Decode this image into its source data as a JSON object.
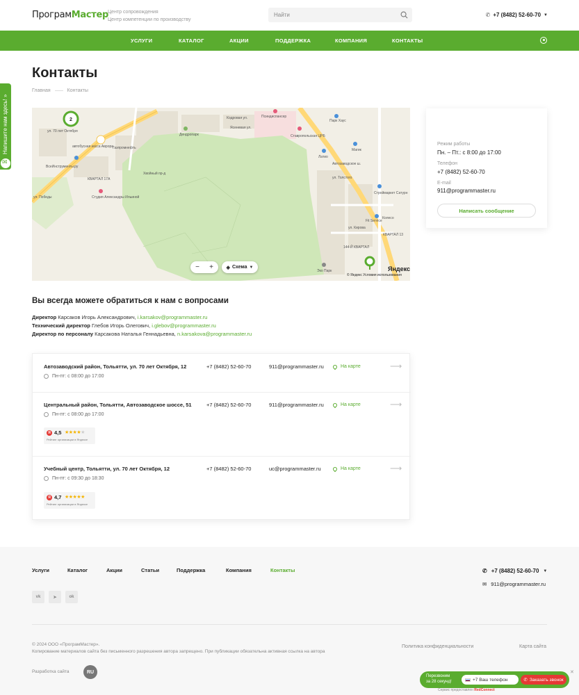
{
  "header": {
    "logo_part1": "Програм",
    "logo_part2": "Мастер",
    "tagline_line1": "Центр сопровождения",
    "tagline_line2": "Центр компетенции по производству",
    "search_placeholder": "Найти",
    "phone": "+7 (8482) 52-60-70"
  },
  "nav": {
    "items": [
      "УСЛУГИ",
      "КАТАЛОГ",
      "АКЦИИ",
      "ПОДДЕРЖКА",
      "КОМПАНИЯ",
      "КОНТАКТЫ"
    ]
  },
  "side_tab": {
    "label": "Напишите нам здесь! »"
  },
  "page": {
    "title": "Контакты",
    "breadcrumbs": [
      "Главная",
      "Контакты"
    ]
  },
  "map": {
    "cluster_count": "2",
    "zoom_minus": "−",
    "zoom_plus": "+",
    "scheme_label": "Схема",
    "brand": "Яндекс",
    "terms": "© Яндекс  Условия использования",
    "labels": [
      "ул. 70 лет Октября",
      "автобусная касса Аврора",
      "Газпромнефть",
      "ВсеИнструменты.ру",
      "Дендропарк",
      "Псиндиспансер",
      "Ставропольская ЦРБ",
      "Парк Хаус",
      "Магик",
      "Латио",
      "Строймаркет Сатурн",
      "Колесо",
      "Fit Service",
      "Студия Александры Ильиной",
      "КВАРТАЛ 17А",
      "КВАРТАЛ 13",
      "144-Й КВАРТАЛ",
      "Автозаводское ш.",
      "ул. Кирова",
      "ул. Толстого",
      "ул. Победы",
      "Эко Парк",
      "Кодровая ул.",
      "Ясеневая ул.",
      "Хвойный пр-д"
    ]
  },
  "info_card": {
    "hours_label": "Режим работы",
    "hours_value": "Пн. – Пт.: с 8:00 до 17:00",
    "phone_label": "Телефон",
    "phone_value": "+7 (8482) 52-60-70",
    "email_label": "E-mail",
    "email_value": "911@programmaster.ru",
    "button": "Написать сообщение"
  },
  "contacts": {
    "title": "Вы всегда можете обратиться к нам с вопросами",
    "people": [
      {
        "role": "Директор",
        "name": "Карсаков Игорь Александрович,",
        "email": "i.karsakov@programmaster.ru"
      },
      {
        "role": "Технический директор",
        "name": "Глебов Игорь Олегович,",
        "email": "i.glebov@programmaster.ru"
      },
      {
        "role": "Директор по персоналу",
        "name": "Карсакова Наталья Геннадьевна,",
        "email": "n.karsakova@programmaster.ru"
      }
    ]
  },
  "offices": [
    {
      "address": "Автозаводский район, Тольятти, ул. 70 лет Октября, 12",
      "hours": "Пн-пт: с 08:00 до 17:00",
      "phone": "+7 (8482) 52-60-70",
      "email": "911@programmaster.ru",
      "map_link": "На карте"
    },
    {
      "address": "Центральный район, Тольятти, Автозаводское шоссе, 51",
      "hours": "Пн-пт: с 08:00 до 17:00",
      "phone": "+7 (8482) 52-60-70",
      "email": "911@programmaster.ru",
      "map_link": "На карте",
      "rating": {
        "score": "4,5",
        "stars": 4.5,
        "caption": "Рейтинг организации в Яндексе"
      }
    },
    {
      "address": "Учебный центр, Тольятти, ул. 70 лет Октября, 12",
      "hours": "Пн-пт: с 09:30 до 18:30",
      "phone": "+7 (8482) 52-60-70",
      "email": "uc@programmaster.ru",
      "map_link": "На карте",
      "rating": {
        "score": "4,7",
        "stars": 5,
        "caption": "Рейтинг организации в Яндексе"
      }
    }
  ],
  "footer": {
    "nav": [
      "Услуги",
      "Каталог",
      "Акции",
      "Статьи",
      "Поддержка",
      "Компания",
      "Контакты"
    ],
    "phone": "+7 (8482) 52-60-70",
    "email": "911@programmaster.ru",
    "social": [
      "vk-icon",
      "telegram-icon",
      "odnoklassniki-icon"
    ],
    "social_labels": [
      "vk",
      "➤",
      "ok"
    ],
    "copyright_line1": "© 2024 ООО «ПрограмМастер».",
    "copyright_line2": "Копирование материалов сайта без письменного разрешения автора запрещено. При публикации обязательна активная ссылка на автора",
    "privacy": "Политика конфиденциальности",
    "sitemap": "Карта сайта",
    "developer_label": "Разработка сайта",
    "developer_logo": "RU"
  },
  "callback": {
    "promo_line1": "Перезвоним",
    "promo_line2": "за 28 секунд!",
    "phone_placeholder": "+7 Ваш телефон",
    "button": "Заказать звонок",
    "credit_prefix": "Сервис предоставлен",
    "credit_brand": "RedConnect"
  },
  "colors": {
    "accent": "#5aac2f",
    "call_button": "#e53935",
    "map_park": "#cfe7b8",
    "map_road": "#ffd877"
  }
}
